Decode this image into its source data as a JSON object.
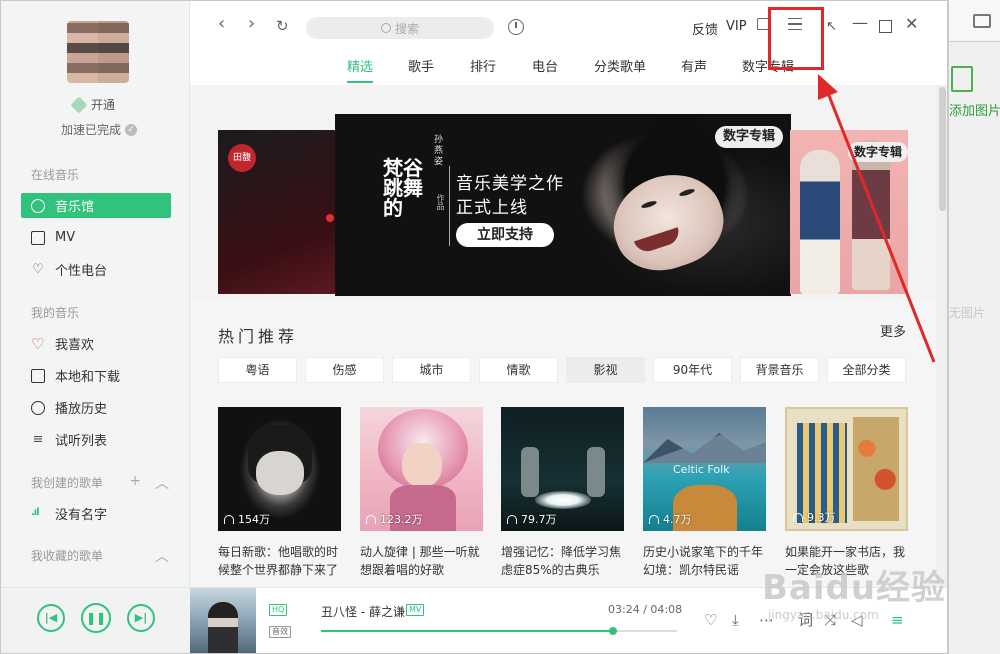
{
  "sidebar": {
    "vip_label": "开通",
    "accel_status": "加速已完成",
    "sections": {
      "online": "在线音乐",
      "mine": "我的音乐",
      "created": "我创建的歌单",
      "collected": "我收藏的歌单"
    },
    "online_items": [
      "音乐馆",
      "MV",
      "个性电台"
    ],
    "mine_items": [
      "我喜欢",
      "本地和下载",
      "播放历史",
      "试听列表"
    ],
    "created_items": [
      "没有名字"
    ]
  },
  "topbar": {
    "search_placeholder": "搜索",
    "feedback": "反馈",
    "vip": "VIP"
  },
  "tabs": [
    "精选",
    "歌手",
    "排行",
    "电台",
    "分类歌单",
    "有声",
    "数字专辑"
  ],
  "active_tab_index": 0,
  "banner": {
    "main": {
      "artist": "孙燕姿",
      "album": "梵谷跳舞的",
      "work": "作品",
      "line1": "音乐美学之作",
      "line2": "正式上线",
      "cta": "立即支持",
      "badge": "数字专辑"
    },
    "right_badge": "数字专辑",
    "left_logo": "田馥",
    "dot_count": 3,
    "active_dot": 1
  },
  "recommend": {
    "title": "热门推荐",
    "more": "更多",
    "categories": [
      "粤语",
      "伤感",
      "城市",
      "情歌",
      "影视",
      "90年代",
      "背景音乐",
      "全部分类"
    ],
    "active_category_index": 4,
    "cards": [
      {
        "plays": "154万",
        "title": "每日新歌：他唱歌的时候整个世界都静下来了"
      },
      {
        "plays": "123.2万",
        "title": "动人旋律 | 那些一听就想跟着唱的好歌"
      },
      {
        "plays": "79.7万",
        "title": "增强记忆：降低学习焦虑症85%的古典乐"
      },
      {
        "plays": "4.7万",
        "title": "历史小说家笔下的千年幻境：凯尔特民谣",
        "cover_label": "Celtic Folk"
      },
      {
        "plays": "9.3万",
        "title": "如果能开一家书店，我一定会放这些歌"
      }
    ]
  },
  "player": {
    "song": "丑八怪 - 薛之谦",
    "quality_tag": "HQ",
    "mv_tag": "MV",
    "effect_tag": "音效",
    "time": "03:24 / 04:08",
    "progress": 0.82
  },
  "background": {
    "add_image": "添加图片",
    "faint_text": "无图片"
  },
  "watermark": {
    "main": "Baidu经验",
    "sub": "jingyan.baidu.com"
  },
  "colors": {
    "accent": "#31c27c",
    "annotation": "#e02828"
  }
}
